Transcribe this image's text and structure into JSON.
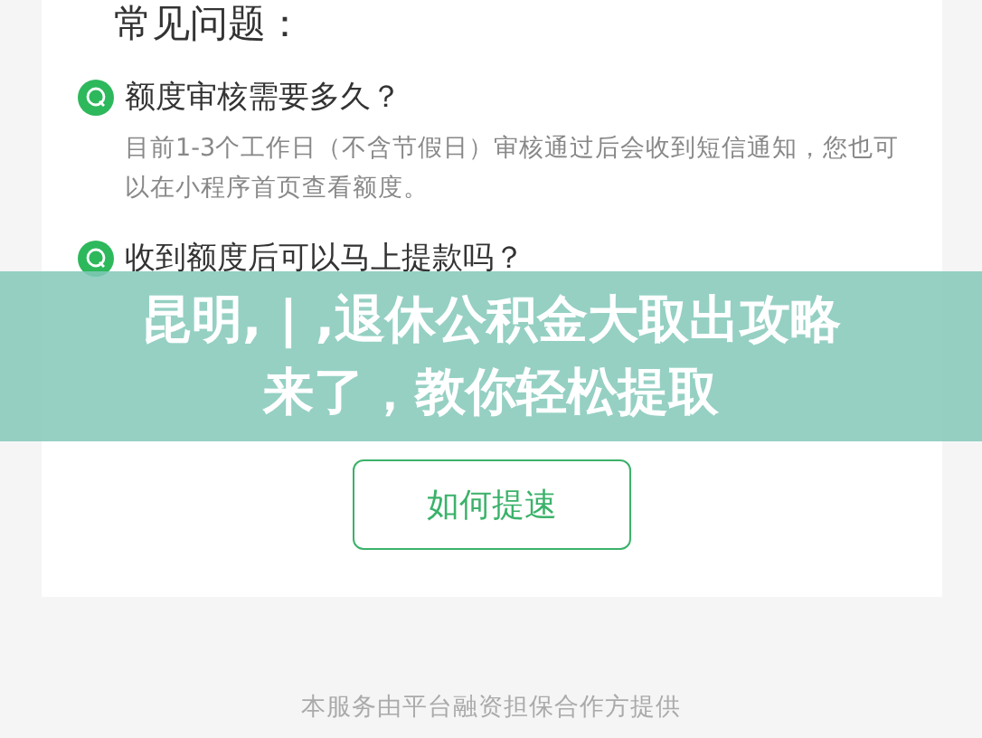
{
  "section_title": "常见问题：",
  "faq": [
    {
      "question": "额度审核需要多久？",
      "answer": "目前1-3个工作日（不含节假日）审核通过后会收到短信通知，您也可以在小程序首页查看额度。"
    },
    {
      "question": "收到额度后可以马上提款吗？"
    }
  ],
  "button": "如何提速",
  "footer": "本服务由平台融资担保合作方提供",
  "headline": "昆明, | ,退休公积金大取出攻略来了，教你轻松提取"
}
